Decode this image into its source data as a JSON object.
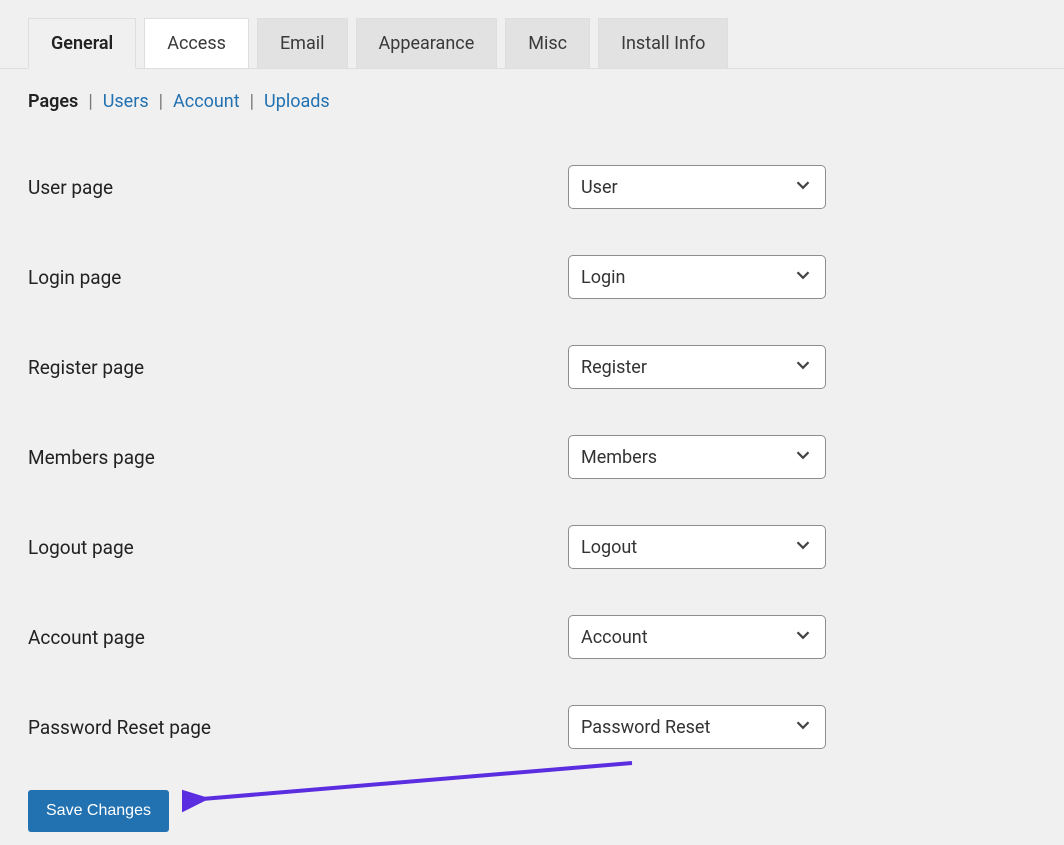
{
  "tabs": [
    {
      "label": "General",
      "active": true
    },
    {
      "label": "Access",
      "active": false
    },
    {
      "label": "Email",
      "active": false
    },
    {
      "label": "Appearance",
      "active": false
    },
    {
      "label": "Misc",
      "active": false
    },
    {
      "label": "Install Info",
      "active": false
    }
  ],
  "subnav": [
    {
      "label": "Pages",
      "active": true
    },
    {
      "label": "Users",
      "active": false
    },
    {
      "label": "Account",
      "active": false
    },
    {
      "label": "Uploads",
      "active": false
    }
  ],
  "fields": [
    {
      "label": "User page",
      "value": "User"
    },
    {
      "label": "Login page",
      "value": "Login"
    },
    {
      "label": "Register page",
      "value": "Register"
    },
    {
      "label": "Members page",
      "value": "Members"
    },
    {
      "label": "Logout page",
      "value": "Logout"
    },
    {
      "label": "Account page",
      "value": "Account"
    },
    {
      "label": "Password Reset page",
      "value": "Password Reset"
    }
  ],
  "save_button_label": "Save Changes"
}
